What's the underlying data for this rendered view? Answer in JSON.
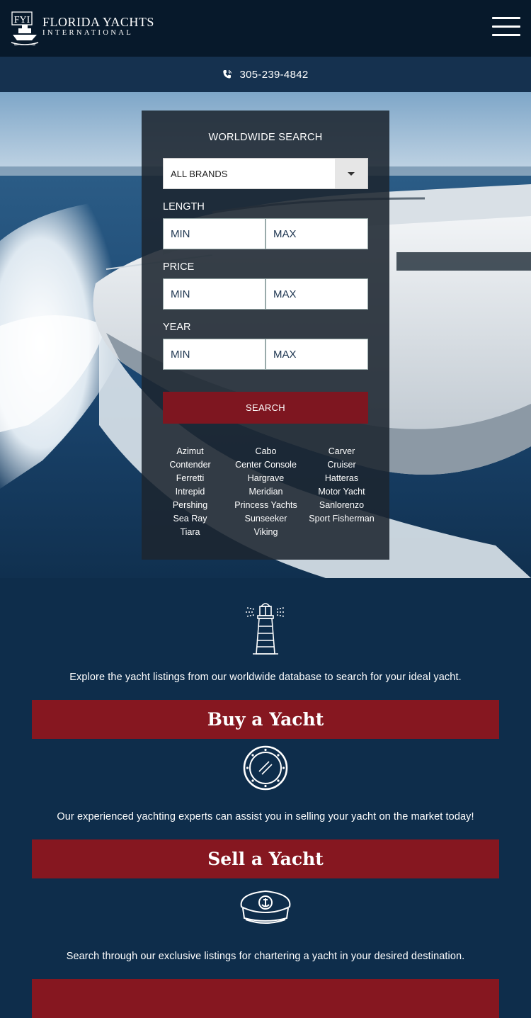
{
  "header": {
    "logo_mark": "FYI",
    "logo_line1": "FLORIDA YACHTS",
    "logo_line2": "INTERNATIONAL",
    "menu_icon": "hamburger-icon"
  },
  "phone_bar": {
    "icon": "phone-icon",
    "number": "305-239-4842"
  },
  "search": {
    "title": "WORLDWIDE SEARCH",
    "brand_select": {
      "value": "ALL BRANDS"
    },
    "length": {
      "label": "LENGTH",
      "min_placeholder": "MIN",
      "max_placeholder": "MAX"
    },
    "price": {
      "label": "PRICE",
      "min_placeholder": "MIN",
      "max_placeholder": "MAX"
    },
    "year": {
      "label": "YEAR",
      "min_placeholder": "MIN",
      "max_placeholder": "MAX"
    },
    "button_label": "SEARCH",
    "brands": [
      "Azimut",
      "Cabo",
      "Carver",
      "Contender",
      "Center Console",
      "Cruiser",
      "Ferretti",
      "Hargrave",
      "Hatteras",
      "Intrepid",
      "Meridian",
      "Motor Yacht",
      "Pershing",
      "Princess Yachts",
      "Sanlorenzo",
      "Sea Ray",
      "Sunseeker",
      "Sport Fisherman",
      "Tiara",
      "Viking"
    ]
  },
  "sections": [
    {
      "icon": "lighthouse-icon",
      "text": "Explore the yacht listings from our worldwide database to search for your ideal yacht.",
      "cta": "Buy a Yacht"
    },
    {
      "icon": "porthole-icon",
      "text": "Our experienced yachting experts can assist you in selling your yacht on the market today!",
      "cta": "Sell a Yacht"
    },
    {
      "icon": "captain-hat-icon",
      "text": "Search through our exclusive listings for chartering a yacht in your desired destination.",
      "cta": ""
    }
  ],
  "colors": {
    "header_bg": "#07192b",
    "phone_bar_bg": "#15314f",
    "section_bg": "#0e2d4b",
    "accent_red": "#861720"
  }
}
